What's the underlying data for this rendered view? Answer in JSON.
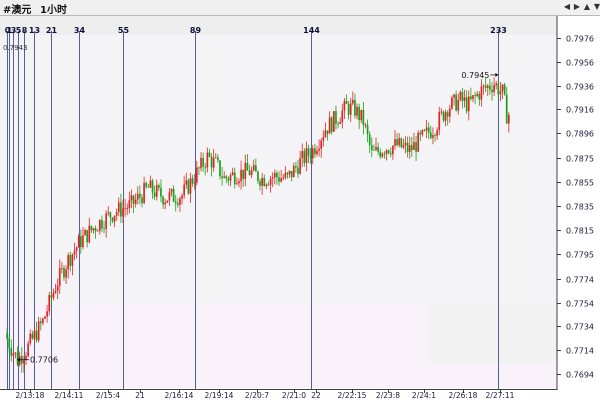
{
  "title": {
    "symbol": "#澳元",
    "period": "1小时"
  },
  "toolbar": {
    "icons": [
      "arrow-left-icon",
      "arrow-right-icon",
      "scroll-up-icon",
      "scroll-down-icon"
    ]
  },
  "chart_data": {
    "type": "candlestick",
    "top_left_value": "0.7943",
    "x_ticks": [
      "2/13:18",
      "2/14:11",
      "2/15:4",
      "21",
      "2/16:14",
      "2/19:14",
      "2/20:7",
      "2/21:0",
      "22",
      "2/22:15",
      "2/23:8",
      "2/24:1",
      "2/26:18",
      "2/27:11"
    ],
    "y_ticks": [
      0.7976,
      0.7956,
      0.7936,
      0.7916,
      0.7896,
      0.7875,
      0.7855,
      0.7835,
      0.7815,
      0.7795,
      0.7774,
      0.7754,
      0.7734,
      0.7714,
      0.7694
    ],
    "ylim": [
      0.7684,
      0.7986
    ],
    "fibonacci_lines": [
      0,
      1,
      3,
      5,
      8,
      13,
      21,
      34,
      55,
      89,
      144,
      233
    ],
    "fibonacci_labels": [
      "0",
      "1",
      "3",
      "5",
      "8",
      "13",
      "21",
      "34",
      "55",
      "89",
      "144",
      "233"
    ],
    "annotations": [
      {
        "label": "0.7945",
        "value": 0.7945,
        "bar": 234,
        "side": "left"
      },
      {
        "label": "0.7706",
        "value": 0.7706,
        "bar": 0,
        "side": "right"
      }
    ],
    "colors": {
      "up": "#e02424",
      "down": "#18a018",
      "fib_line": "#5060a0",
      "axis_text": "#1a1a3a"
    },
    "path": [
      [
        0,
        0.7728
      ],
      [
        3,
        0.7716
      ],
      [
        6,
        0.7706
      ],
      [
        10,
        0.7714
      ],
      [
        14,
        0.7726
      ],
      [
        18,
        0.7738
      ],
      [
        24,
        0.7768
      ],
      [
        30,
        0.779
      ],
      [
        36,
        0.7806
      ],
      [
        44,
        0.782
      ],
      [
        52,
        0.783
      ],
      [
        60,
        0.7836
      ],
      [
        68,
        0.785
      ],
      [
        76,
        0.7842
      ],
      [
        84,
        0.7844
      ],
      [
        90,
        0.786
      ],
      [
        96,
        0.7876
      ],
      [
        100,
        0.787
      ],
      [
        104,
        0.7858
      ],
      [
        110,
        0.7862
      ],
      [
        116,
        0.7864
      ],
      [
        122,
        0.7858
      ],
      [
        128,
        0.786
      ],
      [
        134,
        0.7858
      ],
      [
        140,
        0.7872
      ],
      [
        146,
        0.7882
      ],
      [
        152,
        0.79
      ],
      [
        158,
        0.791
      ],
      [
        162,
        0.7918
      ],
      [
        166,
        0.7916
      ],
      [
        170,
        0.7906
      ],
      [
        174,
        0.7878
      ],
      [
        180,
        0.7884
      ],
      [
        186,
        0.7886
      ],
      [
        192,
        0.7882
      ],
      [
        198,
        0.7892
      ],
      [
        204,
        0.7902
      ],
      [
        210,
        0.7918
      ],
      [
        216,
        0.7924
      ],
      [
        220,
        0.792
      ],
      [
        226,
        0.7932
      ],
      [
        232,
        0.7938
      ],
      [
        236,
        0.793
      ],
      [
        238,
        0.7912
      ]
    ]
  }
}
